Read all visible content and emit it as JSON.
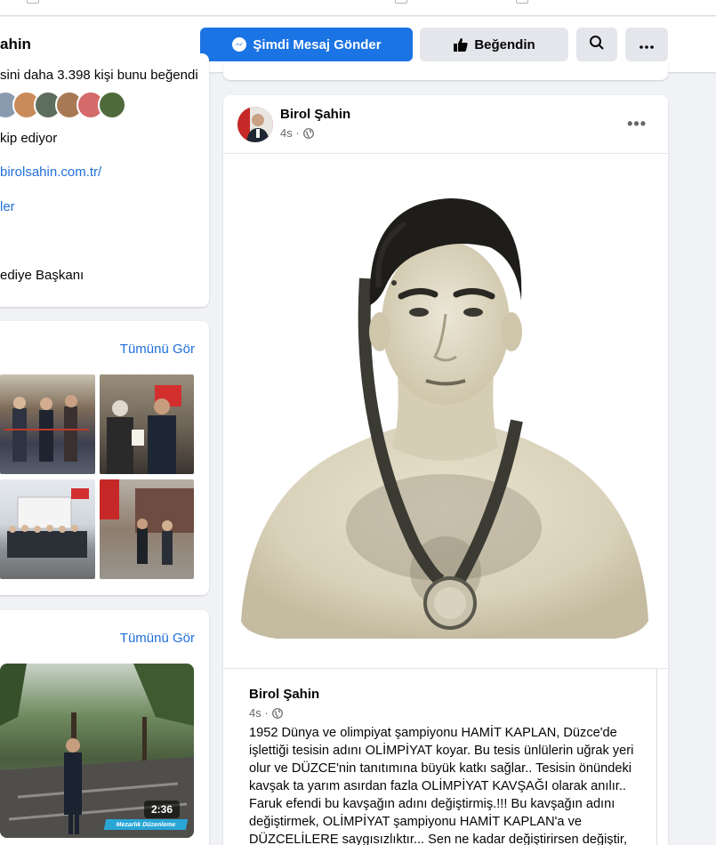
{
  "header": {
    "page_name": "ahin",
    "message_button": "Şimdi Mesaj Gönder",
    "like_button": "Beğendin",
    "search_icon": "search-icon",
    "more_icon": "more-icon"
  },
  "intro": {
    "likes_text": "sini daha 3.398 kişi bunu beğendi",
    "follow_text": "kip ediyor",
    "website": "birolsahin.com.tr/",
    "category": "ler",
    "title": "ediye Başkanı"
  },
  "photos_section": {
    "see_all": "Tümünü Gör"
  },
  "videos_section": {
    "see_all": "Tümünü Gör",
    "duration": "2:36",
    "caption": "Mezarlık Düzenleme"
  },
  "post": {
    "author": "Birol Şahin",
    "time": "4s ·",
    "more": "•••",
    "shared_author": "Birol Şahin",
    "shared_time": "4s ·",
    "body": "1952 Dünya ve olimpiyat şampiyonu HAMİT KAPLAN,  Düzce'de işlettiği tesisin adını OLİMPİYAT koyar. Bu tesis ünlülerin uğrak yeri olur ve DÜZCE'nin tanıtımına büyük katkı sağlar.. Tesisin önündeki kavşak ta yarım asırdan fazla OLİMPİYAT KAVŞAĞI olarak anılır.. Faruk efendi bu kavşağın adını değiştirmiş.!!! Bu kavşağın adını değiştirmek, OLİMPİYAT şampiyonu HAMİT KAPLAN'a ve DÜZCELİLERE saygısızlıktır... Sen ne kadar değiştirirsen değiştir,"
  },
  "colors": {
    "primary": "#1b74e4",
    "link": "#216fdb",
    "secondary_btn": "#e4e6eb",
    "page_bg": "#f0f2f5"
  }
}
